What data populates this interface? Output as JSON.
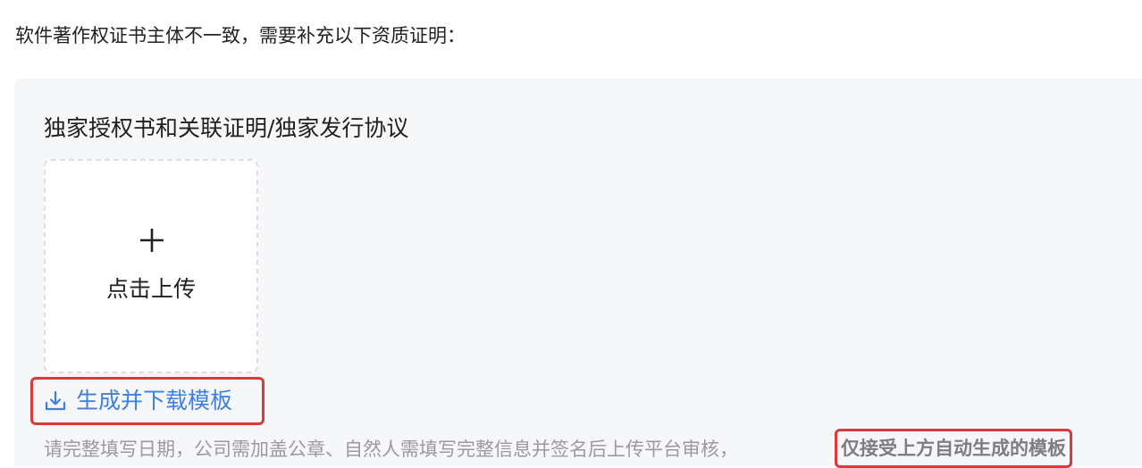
{
  "notice": {
    "text": "软件著作权证书主体不一致，需要补充以下资质证明："
  },
  "section": {
    "title": "独家授权书和关联证明/独家发行协议",
    "upload": {
      "icon": "plus-icon",
      "label": "点击上传"
    },
    "generate_button": {
      "icon": "download-icon",
      "label": "生成并下载模板",
      "color": "#3f7fe0"
    },
    "hint": {
      "text": "请完整填写日期，公司需加盖公章、自然人需填写完整信息并签名后上传平台审核，",
      "emphasis": "仅接受上方自动生成的模板"
    }
  },
  "colors": {
    "highlight_border": "#d93a3a",
    "panel_background": "#f6f7f9",
    "link": "#3f7fe0"
  }
}
